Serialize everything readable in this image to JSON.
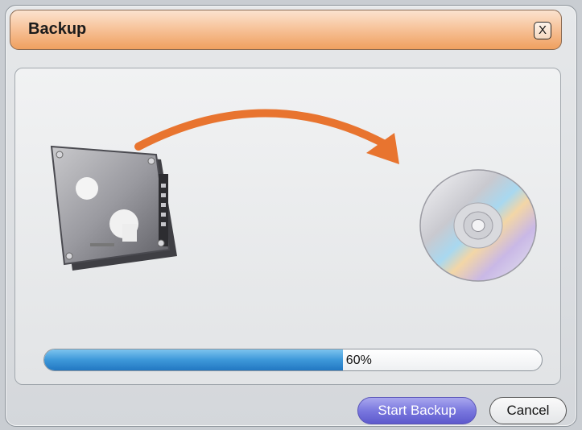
{
  "window": {
    "title": "Backup",
    "close_label": "X"
  },
  "progress": {
    "value": 0.6,
    "label": "60%"
  },
  "buttons": {
    "start_label": "Start Backup",
    "cancel_label": "Cancel"
  },
  "icons": {
    "source": "hard-drive-icon",
    "destination": "cd-disc-icon",
    "transfer": "curved-arrow-icon"
  },
  "colors": {
    "title_bar": "#f3b17d",
    "arrow": "#e8742f",
    "progress_fill": "#3d98d9",
    "start_button": "#7a78df"
  }
}
